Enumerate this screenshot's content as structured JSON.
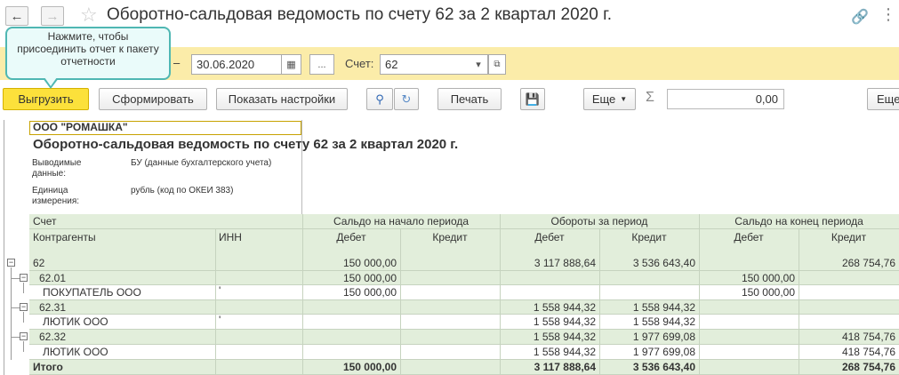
{
  "window": {
    "title": "Оборотно-сальдовая ведомость по счету 62 за 2 квартал 2020 г.",
    "back_icon": "arrow-left",
    "forward_icon": "arrow-right"
  },
  "tooltip": {
    "text": "Нажмите, чтобы присоединить отчет к пакету отчетности"
  },
  "settings": {
    "period_dash": "–",
    "date_to": "30.06.2020",
    "more_button": "...",
    "account_label": "Счет:",
    "account_value": "62"
  },
  "toolbar": {
    "upload": "Выгрузить",
    "generate": "Сформировать",
    "show_settings": "Показать настройки",
    "print": "Печать",
    "more": "Еще",
    "sum_value": "0,00",
    "more_right": "Еще"
  },
  "report": {
    "company": "ООО \"РОМАШКА\"",
    "title": "Оборотно-сальдовая ведомость по счету 62 за 2 квартал 2020 г.",
    "meta": [
      {
        "label": "Выводимые данные:",
        "value": "БУ (данные бухгалтерского учета)"
      },
      {
        "label": "Единица измерения:",
        "value": "рубль (код по ОКЕИ 383)"
      }
    ],
    "headers": {
      "account": "Счет",
      "counterparties": "Контрагенты",
      "inn": "ИНН",
      "opening": "Сальдо на начало периода",
      "turnover": "Обороты за период",
      "closing": "Сальдо на конец периода",
      "debit": "Дебет",
      "credit": "Кредит"
    },
    "rows": [
      {
        "name": "62",
        "inn": "",
        "od": "150 000,00",
        "oc": "",
        "td": "3 117 888,64",
        "tc": "3 536 643,40",
        "cd": "",
        "cc": "268 754,76"
      },
      {
        "name": "62.01",
        "inn": "",
        "od": "150 000,00",
        "oc": "",
        "td": "",
        "tc": "",
        "cd": "150 000,00",
        "cc": ""
      },
      {
        "name": "ПОКУПАТЕЛЬ ООО",
        "inn": "'",
        "od": "150 000,00",
        "oc": "",
        "td": "",
        "tc": "",
        "cd": "150 000,00",
        "cc": ""
      },
      {
        "name": "62.31",
        "inn": "",
        "od": "",
        "oc": "",
        "td": "1 558 944,32",
        "tc": "1 558 944,32",
        "cd": "",
        "cc": ""
      },
      {
        "name": "ЛЮТИК ООО",
        "inn": "'",
        "od": "",
        "oc": "",
        "td": "1 558 944,32",
        "tc": "1 558 944,32",
        "cd": "",
        "cc": ""
      },
      {
        "name": "62.32",
        "inn": "",
        "od": "",
        "oc": "",
        "td": "1 558 944,32",
        "tc": "1 977 699,08",
        "cd": "",
        "cc": "418 754,76"
      },
      {
        "name": "ЛЮТИК ООО",
        "inn": "",
        "od": "",
        "oc": "",
        "td": "1 558 944,32",
        "tc": "1 977 699,08",
        "cd": "",
        "cc": "418 754,76"
      },
      {
        "name": "Итого",
        "inn": "",
        "od": "150 000,00",
        "oc": "",
        "td": "3 117 888,64",
        "tc": "3 536 643,40",
        "cd": "",
        "cc": "268 754,76"
      }
    ]
  }
}
